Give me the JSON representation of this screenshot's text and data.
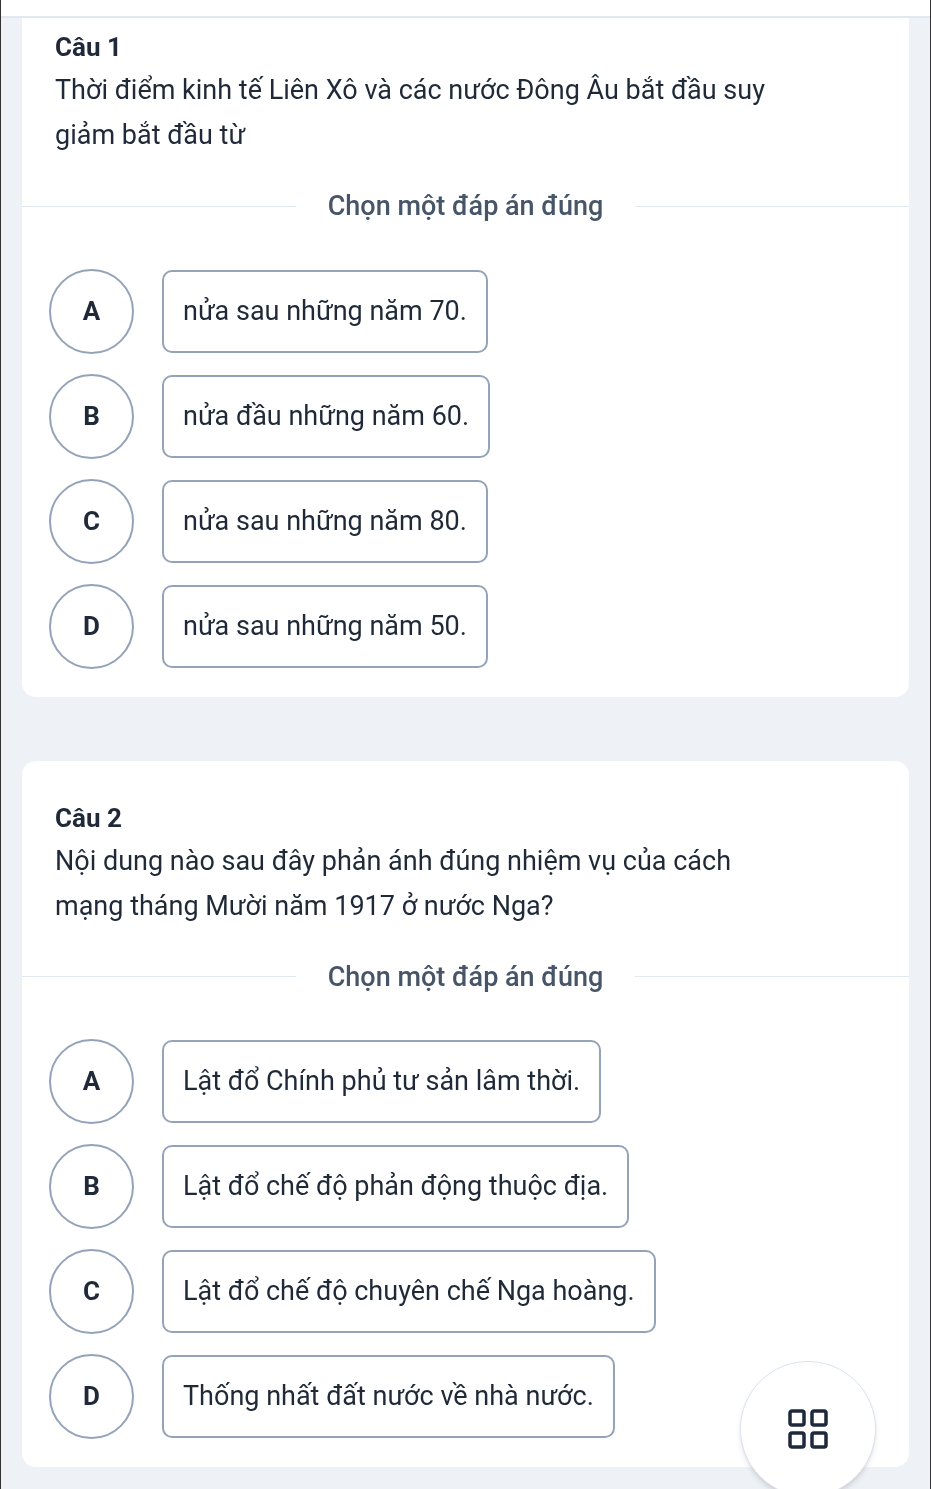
{
  "questions": [
    {
      "title": "Câu 1",
      "text": "Thời điểm kinh tế Liên Xô và các nước Đông Âu bắt đầu suy giảm bắt đầu từ",
      "prompt": "Chọn một đáp án đúng",
      "options": [
        {
          "letter": "A",
          "text": "nửa sau những năm 70."
        },
        {
          "letter": "B",
          "text": "nửa đầu những năm 60."
        },
        {
          "letter": "C",
          "text": "nửa sau những năm 80."
        },
        {
          "letter": "D",
          "text": "nửa sau những năm 50."
        }
      ]
    },
    {
      "title": "Câu 2",
      "text": "Nội dung nào sau đây phản ánh đúng nhiệm vụ của cách mạng tháng Mười năm 1917 ở nước Nga?",
      "prompt": "Chọn một đáp án đúng",
      "options": [
        {
          "letter": "A",
          "text": "Lật đổ Chính phủ tư sản lâm thời."
        },
        {
          "letter": "B",
          "text": "Lật đổ chế độ phản động thuộc địa."
        },
        {
          "letter": "C",
          "text": "Lật đổ chế độ chuyên chế Nga hoàng."
        },
        {
          "letter": "D",
          "text": "Thống nhất đất nước về nhà nước."
        }
      ]
    }
  ]
}
